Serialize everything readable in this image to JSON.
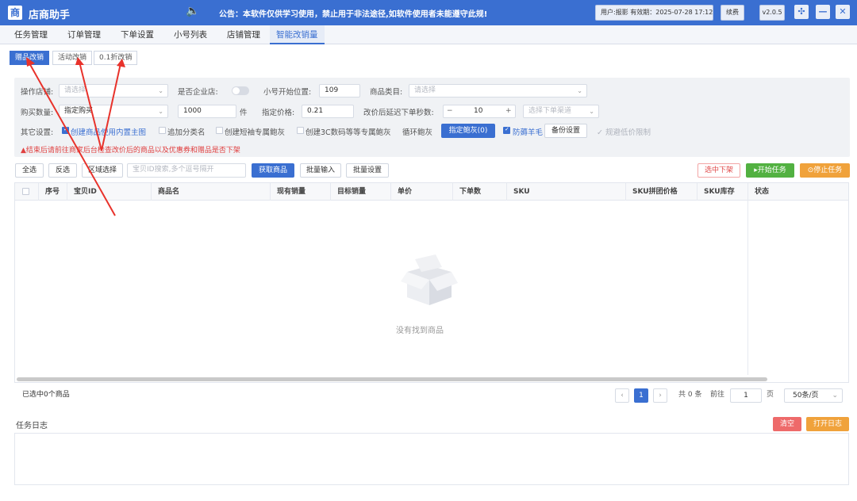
{
  "titlebar": {
    "logo_char": "商",
    "app_title": "店商助手",
    "notice": "公告：本软件仅供学习使用，禁止用于非法途径,如软件使用者未能遵守此规!",
    "user_info": "用户:报影 有效期：2025-07-28 17:12:28",
    "renew_label": "续费",
    "version": "v2.0.5"
  },
  "tabs": [
    "任务管理",
    "订单管理",
    "下单设置",
    "小号列表",
    "店铺管理",
    "智能改销量"
  ],
  "subtabs": [
    "赠品改销",
    "活动改销",
    "0.1折改销"
  ],
  "form": {
    "shop_label": "操作店铺:",
    "shop_placeholder": "请选择",
    "enterprise_label": "是否企业店:",
    "start_pos_label": "小号开始位置:",
    "start_pos_value": "109",
    "category_label": "商品类目:",
    "category_placeholder": "请选择",
    "qty_label": "购买数量:",
    "qty_value": "指定购买",
    "qty_num": "1000",
    "qty_unit": "件",
    "price_label": "指定价格:",
    "price_value": "0.21",
    "delay_label": "改价后延迟下单秒数:",
    "delay_value": "10",
    "channel_placeholder": "选择下单渠道",
    "other_label": "其它设置:",
    "opt1": "创建商品使用内置主图",
    "opt2": "追加分类名",
    "opt3": "创建短袖专属鲍灰",
    "opt4": "创建3C数码等等专属鲍灰",
    "loop_label": "循环鲍灰",
    "assign_btn": "指定鲍灰(0)",
    "opt5": "防薅羊毛",
    "price_setting_btn": "备份设置",
    "opt6": "规避低价限制",
    "warning": "▲结束后请前往商家后台检查改价后的商品以及优惠券和赠品是否下架"
  },
  "toolbar": {
    "select_all": "全选",
    "invert": "反选",
    "range": "区域选择",
    "id_placeholder": "宝贝ID搜索,多个逗号隔开",
    "fetch": "获取商品",
    "batch_input": "批量输入",
    "batch_set": "批量设置",
    "delist": "选中下架",
    "start": "▸开始任务",
    "stop": "⊙停止任务"
  },
  "grid": {
    "columns": [
      "序号",
      "宝贝ID",
      "商品名",
      "现有销量",
      "目标销量",
      "单价",
      "下单数",
      "SKU",
      "SKU拼团价格",
      "SKU库存",
      "状态"
    ],
    "empty_text": "没有找到商品"
  },
  "pager": {
    "selected": "已选中0个商品",
    "prev": "‹",
    "current": "1",
    "next": "›",
    "total": "共 0 条",
    "goto": "前往",
    "page_value": "1",
    "page_unit": "页",
    "page_size": "50条/页"
  },
  "log": {
    "title": "任务日志",
    "clear": "清空",
    "open": "打开日志"
  },
  "colors": {
    "primary": "#3a6fd1",
    "annotation": "#e8322b"
  }
}
